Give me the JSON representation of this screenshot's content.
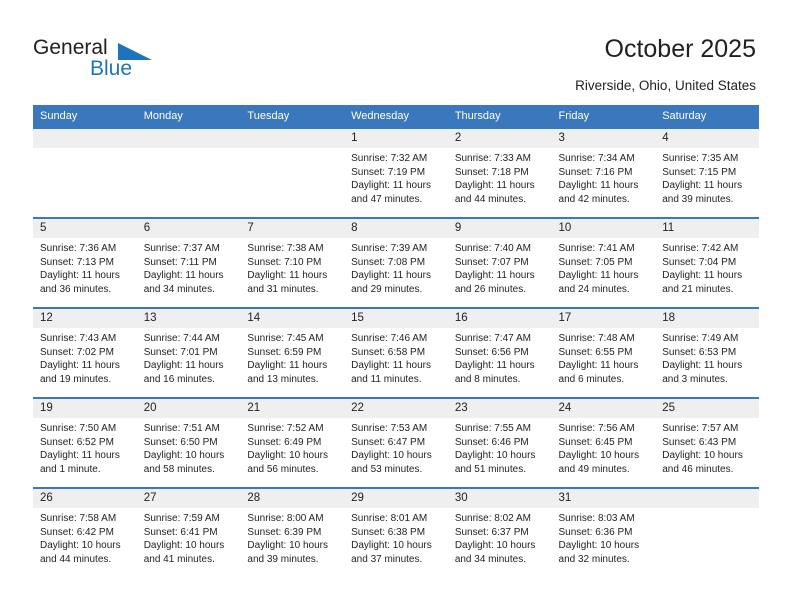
{
  "logo": {
    "primary_text": "General",
    "secondary_text": "Blue",
    "accent_color": "#1c75bc",
    "triangle_icon": "triangle-icon"
  },
  "header": {
    "title": "October 2025",
    "subtitle": "Riverside, Ohio, United States"
  },
  "theme": {
    "header_blue": "#3b77bc",
    "daynum_gray": "#efefef",
    "text": "#231f20"
  },
  "weekday_headers": [
    "Sunday",
    "Monday",
    "Tuesday",
    "Wednesday",
    "Thursday",
    "Friday",
    "Saturday"
  ],
  "weeks": [
    [
      {
        "day": "",
        "empty": true
      },
      {
        "day": "",
        "empty": true
      },
      {
        "day": "",
        "empty": true
      },
      {
        "day": "1",
        "sunrise": "Sunrise: 7:32 AM",
        "sunset": "Sunset: 7:19 PM",
        "daylight_1": "Daylight: 11 hours",
        "daylight_2": "and 47 minutes."
      },
      {
        "day": "2",
        "sunrise": "Sunrise: 7:33 AM",
        "sunset": "Sunset: 7:18 PM",
        "daylight_1": "Daylight: 11 hours",
        "daylight_2": "and 44 minutes."
      },
      {
        "day": "3",
        "sunrise": "Sunrise: 7:34 AM",
        "sunset": "Sunset: 7:16 PM",
        "daylight_1": "Daylight: 11 hours",
        "daylight_2": "and 42 minutes."
      },
      {
        "day": "4",
        "sunrise": "Sunrise: 7:35 AM",
        "sunset": "Sunset: 7:15 PM",
        "daylight_1": "Daylight: 11 hours",
        "daylight_2": "and 39 minutes."
      }
    ],
    [
      {
        "day": "5",
        "sunrise": "Sunrise: 7:36 AM",
        "sunset": "Sunset: 7:13 PM",
        "daylight_1": "Daylight: 11 hours",
        "daylight_2": "and 36 minutes."
      },
      {
        "day": "6",
        "sunrise": "Sunrise: 7:37 AM",
        "sunset": "Sunset: 7:11 PM",
        "daylight_1": "Daylight: 11 hours",
        "daylight_2": "and 34 minutes."
      },
      {
        "day": "7",
        "sunrise": "Sunrise: 7:38 AM",
        "sunset": "Sunset: 7:10 PM",
        "daylight_1": "Daylight: 11 hours",
        "daylight_2": "and 31 minutes."
      },
      {
        "day": "8",
        "sunrise": "Sunrise: 7:39 AM",
        "sunset": "Sunset: 7:08 PM",
        "daylight_1": "Daylight: 11 hours",
        "daylight_2": "and 29 minutes."
      },
      {
        "day": "9",
        "sunrise": "Sunrise: 7:40 AM",
        "sunset": "Sunset: 7:07 PM",
        "daylight_1": "Daylight: 11 hours",
        "daylight_2": "and 26 minutes."
      },
      {
        "day": "10",
        "sunrise": "Sunrise: 7:41 AM",
        "sunset": "Sunset: 7:05 PM",
        "daylight_1": "Daylight: 11 hours",
        "daylight_2": "and 24 minutes."
      },
      {
        "day": "11",
        "sunrise": "Sunrise: 7:42 AM",
        "sunset": "Sunset: 7:04 PM",
        "daylight_1": "Daylight: 11 hours",
        "daylight_2": "and 21 minutes."
      }
    ],
    [
      {
        "day": "12",
        "sunrise": "Sunrise: 7:43 AM",
        "sunset": "Sunset: 7:02 PM",
        "daylight_1": "Daylight: 11 hours",
        "daylight_2": "and 19 minutes."
      },
      {
        "day": "13",
        "sunrise": "Sunrise: 7:44 AM",
        "sunset": "Sunset: 7:01 PM",
        "daylight_1": "Daylight: 11 hours",
        "daylight_2": "and 16 minutes."
      },
      {
        "day": "14",
        "sunrise": "Sunrise: 7:45 AM",
        "sunset": "Sunset: 6:59 PM",
        "daylight_1": "Daylight: 11 hours",
        "daylight_2": "and 13 minutes."
      },
      {
        "day": "15",
        "sunrise": "Sunrise: 7:46 AM",
        "sunset": "Sunset: 6:58 PM",
        "daylight_1": "Daylight: 11 hours",
        "daylight_2": "and 11 minutes."
      },
      {
        "day": "16",
        "sunrise": "Sunrise: 7:47 AM",
        "sunset": "Sunset: 6:56 PM",
        "daylight_1": "Daylight: 11 hours",
        "daylight_2": "and 8 minutes."
      },
      {
        "day": "17",
        "sunrise": "Sunrise: 7:48 AM",
        "sunset": "Sunset: 6:55 PM",
        "daylight_1": "Daylight: 11 hours",
        "daylight_2": "and 6 minutes."
      },
      {
        "day": "18",
        "sunrise": "Sunrise: 7:49 AM",
        "sunset": "Sunset: 6:53 PM",
        "daylight_1": "Daylight: 11 hours",
        "daylight_2": "and 3 minutes."
      }
    ],
    [
      {
        "day": "19",
        "sunrise": "Sunrise: 7:50 AM",
        "sunset": "Sunset: 6:52 PM",
        "daylight_1": "Daylight: 11 hours",
        "daylight_2": "and 1 minute."
      },
      {
        "day": "20",
        "sunrise": "Sunrise: 7:51 AM",
        "sunset": "Sunset: 6:50 PM",
        "daylight_1": "Daylight: 10 hours",
        "daylight_2": "and 58 minutes."
      },
      {
        "day": "21",
        "sunrise": "Sunrise: 7:52 AM",
        "sunset": "Sunset: 6:49 PM",
        "daylight_1": "Daylight: 10 hours",
        "daylight_2": "and 56 minutes."
      },
      {
        "day": "22",
        "sunrise": "Sunrise: 7:53 AM",
        "sunset": "Sunset: 6:47 PM",
        "daylight_1": "Daylight: 10 hours",
        "daylight_2": "and 53 minutes."
      },
      {
        "day": "23",
        "sunrise": "Sunrise: 7:55 AM",
        "sunset": "Sunset: 6:46 PM",
        "daylight_1": "Daylight: 10 hours",
        "daylight_2": "and 51 minutes."
      },
      {
        "day": "24",
        "sunrise": "Sunrise: 7:56 AM",
        "sunset": "Sunset: 6:45 PM",
        "daylight_1": "Daylight: 10 hours",
        "daylight_2": "and 49 minutes."
      },
      {
        "day": "25",
        "sunrise": "Sunrise: 7:57 AM",
        "sunset": "Sunset: 6:43 PM",
        "daylight_1": "Daylight: 10 hours",
        "daylight_2": "and 46 minutes."
      }
    ],
    [
      {
        "day": "26",
        "sunrise": "Sunrise: 7:58 AM",
        "sunset": "Sunset: 6:42 PM",
        "daylight_1": "Daylight: 10 hours",
        "daylight_2": "and 44 minutes."
      },
      {
        "day": "27",
        "sunrise": "Sunrise: 7:59 AM",
        "sunset": "Sunset: 6:41 PM",
        "daylight_1": "Daylight: 10 hours",
        "daylight_2": "and 41 minutes."
      },
      {
        "day": "28",
        "sunrise": "Sunrise: 8:00 AM",
        "sunset": "Sunset: 6:39 PM",
        "daylight_1": "Daylight: 10 hours",
        "daylight_2": "and 39 minutes."
      },
      {
        "day": "29",
        "sunrise": "Sunrise: 8:01 AM",
        "sunset": "Sunset: 6:38 PM",
        "daylight_1": "Daylight: 10 hours",
        "daylight_2": "and 37 minutes."
      },
      {
        "day": "30",
        "sunrise": "Sunrise: 8:02 AM",
        "sunset": "Sunset: 6:37 PM",
        "daylight_1": "Daylight: 10 hours",
        "daylight_2": "and 34 minutes."
      },
      {
        "day": "31",
        "sunrise": "Sunrise: 8:03 AM",
        "sunset": "Sunset: 6:36 PM",
        "daylight_1": "Daylight: 10 hours",
        "daylight_2": "and 32 minutes."
      },
      {
        "day": "",
        "empty": true
      }
    ]
  ]
}
